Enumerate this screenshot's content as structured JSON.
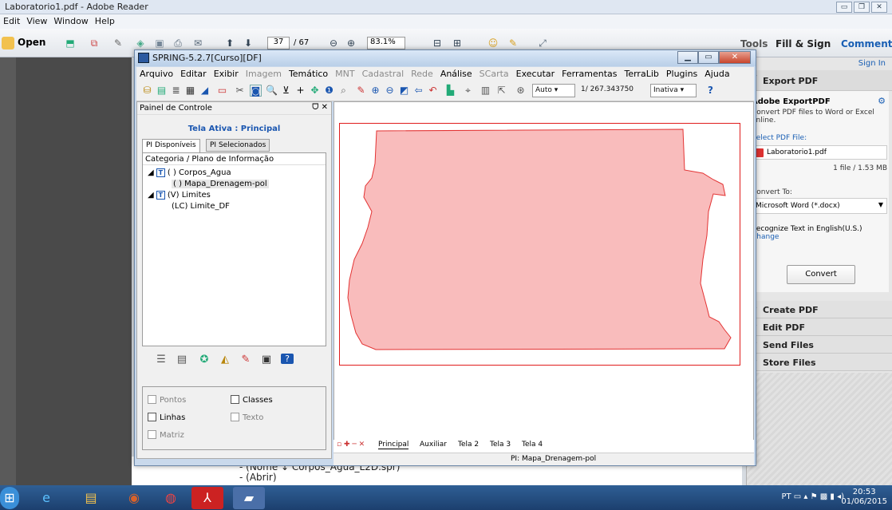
{
  "reader": {
    "title": "Laboratorio1.pdf - Adobe Reader",
    "menu": [
      "Edit",
      "View",
      "Window",
      "Help"
    ],
    "toolbar": {
      "open": "Open",
      "page": "37",
      "pages": "/ 67",
      "zoom": "83.1%",
      "tools": "Tools",
      "fill_sign": "Fill & Sign",
      "comment": "Comment"
    },
    "right_panel": {
      "sign_in": "Sign In",
      "export_pdf": "Export PDF",
      "adobe_export": "Adobe ExportPDF",
      "export_desc": "Convert PDF files to Word or Excel online.",
      "select_file": "Select PDF File:",
      "file_name": "Laboratorio1.pdf",
      "file_info": "1 file / 1.53 MB",
      "convert_to": "Convert To:",
      "format": "Microsoft Word (*.docx)",
      "recognize": "Recognize Text in English(U.S.)",
      "change": "Change",
      "convert_btn": "Convert",
      "create_pdf": "Create PDF",
      "edit_pdf": "Edit PDF",
      "send_files": "Send Files",
      "store_files": "Store Files"
    },
    "doc_lines": [
      "- (Nome ↓ Corpos_Agua_L2D.spr)",
      "- (Abrir)"
    ]
  },
  "spring": {
    "title": "SPRING-5.2.7[Curso][DF]",
    "menu": [
      {
        "label": "Arquivo",
        "enabled": true
      },
      {
        "label": "Editar",
        "enabled": true
      },
      {
        "label": "Exibir",
        "enabled": true
      },
      {
        "label": "Imagem",
        "enabled": false
      },
      {
        "label": "Temático",
        "enabled": true
      },
      {
        "label": "MNT",
        "enabled": false
      },
      {
        "label": "Cadastral",
        "enabled": false
      },
      {
        "label": "Rede",
        "enabled": false
      },
      {
        "label": "Análise",
        "enabled": true
      },
      {
        "label": "SCarta",
        "enabled": false
      },
      {
        "label": "Executar",
        "enabled": true
      },
      {
        "label": "Ferramentas",
        "enabled": true
      },
      {
        "label": "TerraLib",
        "enabled": true
      },
      {
        "label": "Plugins",
        "enabled": true
      },
      {
        "label": "Ajuda",
        "enabled": true
      }
    ],
    "toolbar": {
      "auto": "Auto",
      "scale": "1/ 267.343750",
      "mode": "Inativa"
    },
    "panel": {
      "title": "Painel de Controle",
      "tela": "Tela Ativa : Principal",
      "tab1": "PI Disponíveis",
      "tab2": "PI Selecionados",
      "tree_header": "Categoria / Plano de Informação",
      "tree": [
        {
          "label": "( ) Corpos_Agua",
          "type": "category"
        },
        {
          "label": "( ) Mapa_Drenagem-pol",
          "type": "pi"
        },
        {
          "label": "(V) Limites",
          "type": "category"
        },
        {
          "label": "(LC) Limite_DF",
          "type": "pi"
        }
      ],
      "checks": {
        "pontos": "Pontos",
        "classes": "Classes",
        "linhas": "Linhas",
        "texto": "Texto",
        "matriz": "Matriz"
      }
    },
    "tabs": [
      "Principal",
      "Auxiliar",
      "Tela 2",
      "Tela 3",
      "Tela 4"
    ],
    "status": "PI: Mapa_Drenagem-pol",
    "map_fill": "#f9bcbc",
    "map_stroke": "#e33333"
  },
  "taskbar": {
    "lang": "PT",
    "time": "20:53",
    "date": "01/06/2015"
  }
}
